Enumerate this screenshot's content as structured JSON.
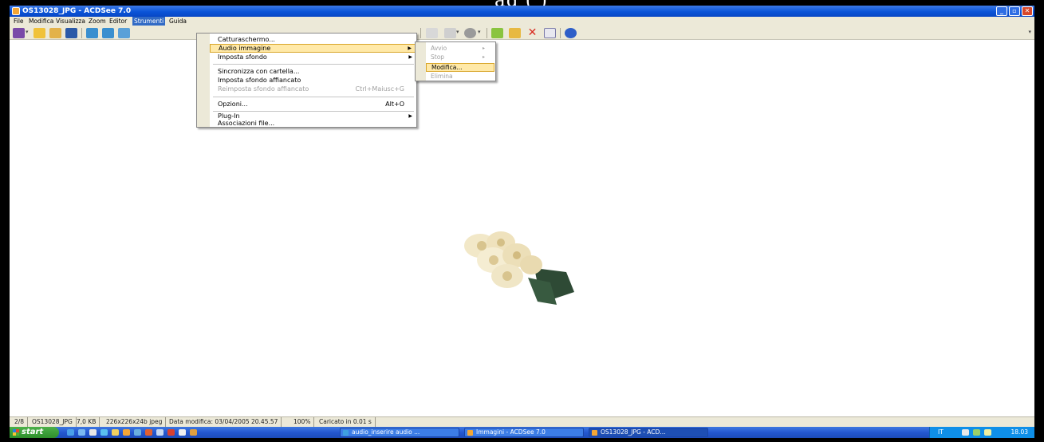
{
  "caption_fragment": "ag                    (          )",
  "window": {
    "title": "OS13028_JPG - ACDSee 7.0",
    "controls": {
      "minimize": "_",
      "maximize": "▫",
      "close": "✕"
    }
  },
  "menubar": {
    "items": [
      "File",
      "Modifica",
      "Visualizza",
      "Zoom",
      "Editor",
      "Strumenti",
      "Guida"
    ],
    "active": "Strumenti"
  },
  "toolbar": {
    "left_icons": [
      "acquire-icon",
      "open-folder-icon",
      "browse-icon",
      "save-icon",
      "rotate-left-icon",
      "rotate-right-icon",
      "fit-icon"
    ],
    "right_icons": [
      "print-icon",
      "email-icon",
      "slideshow-icon",
      "copy-to-icon",
      "move-to-icon",
      "delete-icon",
      "properties-icon",
      "help-icon"
    ]
  },
  "strumenti_menu": {
    "items": [
      {
        "label": "Catturaschermo...",
        "shortcut": "",
        "arrow": false,
        "disabled": false,
        "highlighted": false
      },
      {
        "label": "Audio immagine",
        "shortcut": "",
        "arrow": true,
        "disabled": false,
        "highlighted": true
      },
      {
        "label": "Imposta sfondo",
        "shortcut": "",
        "arrow": true,
        "disabled": false,
        "highlighted": false
      },
      {
        "label": "Sincronizza con cartella...",
        "shortcut": "",
        "arrow": false,
        "disabled": false,
        "highlighted": false
      },
      {
        "label": "Imposta sfondo affiancato",
        "shortcut": "",
        "arrow": false,
        "disabled": false,
        "highlighted": false
      },
      {
        "label": "Reimposta sfondo affiancato",
        "shortcut": "Ctrl+Maiusc+G",
        "arrow": false,
        "disabled": true,
        "highlighted": false
      },
      {
        "label": "Opzioni...",
        "shortcut": "Alt+O",
        "arrow": false,
        "disabled": false,
        "highlighted": false
      },
      {
        "label": "Plug-In",
        "shortcut": "",
        "arrow": true,
        "disabled": false,
        "highlighted": false
      },
      {
        "label": "Associazioni file...",
        "shortcut": "",
        "arrow": false,
        "disabled": false,
        "highlighted": false
      }
    ]
  },
  "audio_submenu": {
    "items": [
      {
        "label": "Avvio",
        "disabled": true,
        "highlighted": false,
        "arrow": true
      },
      {
        "label": "Stop",
        "disabled": true,
        "highlighted": false,
        "arrow": true
      },
      {
        "label": "Modifica...",
        "disabled": false,
        "highlighted": true,
        "arrow": false
      },
      {
        "label": "Elimina",
        "disabled": true,
        "highlighted": false,
        "arrow": false
      }
    ]
  },
  "statusbar": {
    "index": "2/8",
    "filename": "OS13028_JPG",
    "filesize": "7,0 KB",
    "dimensions": "226x226x24b jpeg",
    "modified": "Data modifica: 03/04/2005 20.45.57",
    "zoom": "100%",
    "load_time": "Caricato in 0.01 s"
  },
  "taskbar": {
    "start_label": "start",
    "tasks": [
      {
        "label": "audio_inserire audio ...",
        "icon_color": "#3fa0e0",
        "active": false
      },
      {
        "label": "Immagini - ACDSee 7.0",
        "icon_color": "#f3a636",
        "active": false
      },
      {
        "label": "OS13028_JPG - ACD...",
        "icon_color": "#f3a636",
        "active": true
      }
    ],
    "language": "IT",
    "clock": "18.03"
  }
}
